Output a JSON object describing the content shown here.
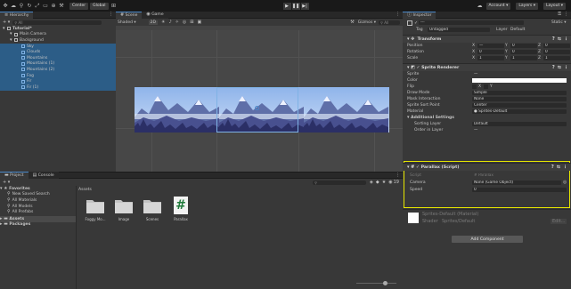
{
  "toolbar": {
    "center_label": "Center",
    "global_label": "Global",
    "account_label": "Account",
    "layers_label": "Layers",
    "layout_label": "Layout"
  },
  "hierarchy": {
    "tab_label": "Hierarchy",
    "search_placeholder": "All",
    "items": [
      {
        "label": "Tutorial*",
        "indent": 0,
        "selected": false
      },
      {
        "label": "Main Camera",
        "indent": 1,
        "selected": false
      },
      {
        "label": "Background",
        "indent": 1,
        "selected": false
      },
      {
        "label": "Sky",
        "indent": 2,
        "selected": true
      },
      {
        "label": "Clouds",
        "indent": 2,
        "selected": true
      },
      {
        "label": "Mountains",
        "indent": 2,
        "selected": true
      },
      {
        "label": "Mountains (1)",
        "indent": 2,
        "selected": true
      },
      {
        "label": "Mountains (2)",
        "indent": 2,
        "selected": true
      },
      {
        "label": "Fog",
        "indent": 2,
        "selected": true
      },
      {
        "label": "Fir",
        "indent": 2,
        "selected": true
      },
      {
        "label": "Fir (1)",
        "indent": 2,
        "selected": true
      }
    ]
  },
  "scene": {
    "tab_scene": "Scene",
    "tab_game": "Game",
    "shading_mode": "Shaded",
    "mode_2d": "2D",
    "gizmos_label": "Gizmos",
    "search_placeholder": "All"
  },
  "inspector": {
    "tab_label": "Inspector",
    "object_name": "---",
    "static_label": "Static",
    "tag_label": "Tag",
    "tag_value": "Untagged",
    "layer_label": "Layer",
    "layer_value": "Default",
    "transform": {
      "title": "Transform",
      "rows": [
        {
          "label": "Position",
          "x": "—",
          "y": "0",
          "z": "0"
        },
        {
          "label": "Rotation",
          "x": "0",
          "y": "0",
          "z": "0"
        },
        {
          "label": "Scale",
          "x": "1",
          "y": "1",
          "z": "1"
        }
      ]
    },
    "sprite_renderer": {
      "title": "Sprite Renderer",
      "sprite_label": "Sprite",
      "sprite_value": "—",
      "color_label": "Color",
      "flip_label": "Flip",
      "flip_x": "X",
      "flip_y": "Y",
      "draw_mode_label": "Draw Mode",
      "draw_mode_value": "Simple",
      "mask_label": "Mask Interaction",
      "mask_value": "None",
      "sort_point_label": "Sprite Sort Point",
      "sort_point_value": "Center",
      "material_label": "Material",
      "material_value": "Sprites-Default",
      "additional_label": "Additional Settings",
      "sorting_layer_label": "Sorting Layer",
      "sorting_layer_value": "Default",
      "order_label": "Order in Layer",
      "order_value": "—"
    },
    "parallax": {
      "title": "Parallax (Script)",
      "script_label": "Script",
      "script_value": "Parallax",
      "camera_label": "Camera",
      "camera_value": "None (Game Object)",
      "speed_label": "Speed",
      "speed_value": "0"
    },
    "material_section": {
      "name": "Sprites-Default (Material)",
      "shader_label": "Shader",
      "shader_value": "Sprites/Default",
      "edit_label": "Edit..."
    },
    "add_component_label": "Add Component"
  },
  "project": {
    "tab_project": "Project",
    "tab_console": "Console",
    "favorites_label": "Favorites",
    "favorite_items": [
      "New Saved Search",
      "All Materials",
      "All Models",
      "All Prefabs"
    ],
    "assets_label": "Assets",
    "packages_label": "Packages",
    "breadcrumb": "Assets",
    "count_label": "19",
    "assets": [
      {
        "name": "Foggy Mo...",
        "kind": "folder"
      },
      {
        "name": "Image",
        "kind": "folder"
      },
      {
        "name": "Scenes",
        "kind": "folder"
      },
      {
        "name": "Parallax",
        "kind": "script"
      }
    ]
  },
  "colors": {
    "selection": "#2c5d87",
    "highlight": "#e6e600",
    "accent": "#4a88c8"
  }
}
